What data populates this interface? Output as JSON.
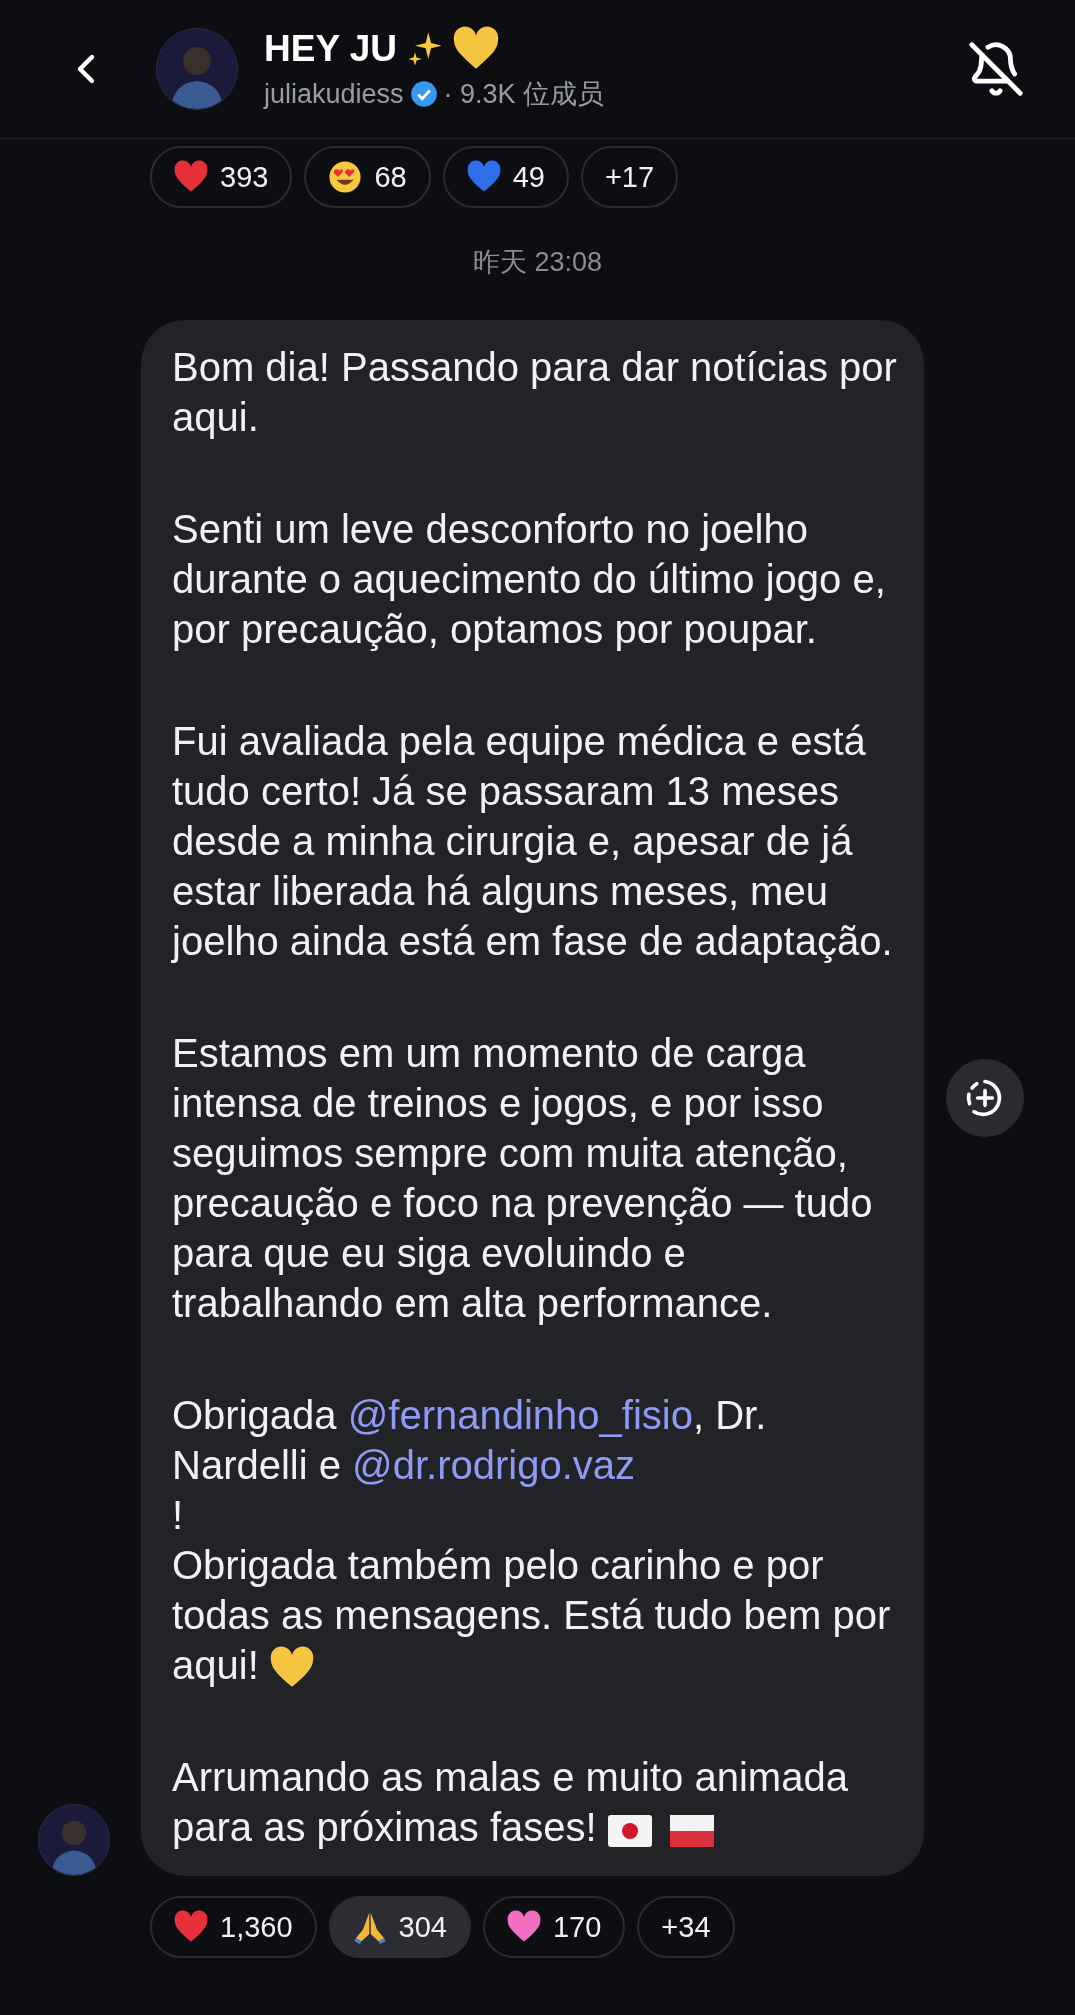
{
  "header": {
    "title": "HEY JU",
    "username": "juliakudiess",
    "members": "· 9.3K 位成员"
  },
  "previous_reactions": [
    {
      "kind": "red-heart",
      "count": "393"
    },
    {
      "kind": "heart-eyes",
      "count": "68"
    },
    {
      "kind": "blue-heart",
      "count": "49"
    },
    {
      "kind": "more",
      "count": "+17"
    }
  ],
  "timestamp": "昨天 23:08",
  "message": {
    "paragraphs": [
      [
        {
          "kind": "text",
          "text": "Bom dia! Passando para dar notícias por aqui."
        }
      ],
      [
        {
          "kind": "text",
          "text": "Senti um leve desconforto no joelho durante o aquecimento do último jogo e, por precaução, optamos por poupar."
        }
      ],
      [
        {
          "kind": "text",
          "text": "Fui avaliada pela equipe médica e está tudo certo! Já se passaram 13 meses desde a minha cirurgia e, apesar de já estar liberada há alguns meses, meu joelho ainda está em fase de adaptação."
        }
      ],
      [
        {
          "kind": "text",
          "text": "Estamos em um momento de carga intensa de treinos e jogos, e por isso seguimos sempre com muita atenção, precaução e foco na prevenção — tudo para que eu siga evoluindo e trabalhando em alta performance."
        }
      ],
      [
        {
          "kind": "text",
          "text": "Obrigada "
        },
        {
          "kind": "mention",
          "text": "@fernandinho_fisio"
        },
        {
          "kind": "text",
          "text": ", Dr. Nardelli e "
        },
        {
          "kind": "mention",
          "text": "@dr.rodrigo.vaz"
        },
        {
          "kind": "break"
        },
        {
          "kind": "text",
          "text": "!"
        },
        {
          "kind": "break"
        },
        {
          "kind": "text",
          "text": "Obrigada também pelo carinho e por todas as mensagens. Está tudo bem por aqui! "
        },
        {
          "kind": "yellow-heart"
        }
      ],
      [
        {
          "kind": "text",
          "text": "Arrumando as malas e muito animada para as próximas fases! "
        },
        {
          "kind": "flag-japan"
        },
        {
          "kind": "flag-poland"
        }
      ]
    ]
  },
  "reactions": [
    {
      "kind": "red-heart",
      "count": "1,360",
      "selected": false
    },
    {
      "kind": "praying-hands",
      "count": "304",
      "selected": true
    },
    {
      "kind": "pink-heart",
      "count": "170",
      "selected": false
    },
    {
      "kind": "more",
      "count": "+34",
      "selected": false
    }
  ]
}
